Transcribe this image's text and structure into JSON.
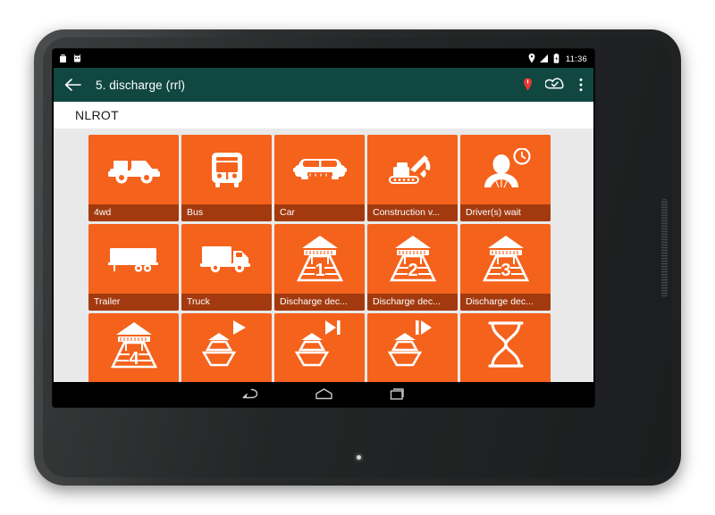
{
  "device": {
    "type": "android-tablet"
  },
  "statusbar": {
    "left_icons": [
      "shopping-bag-icon",
      "robot-icon"
    ],
    "right_icons": [
      "location-icon",
      "signal-icon",
      "battery-icon"
    ],
    "time": "11:36"
  },
  "appbar": {
    "back_label": "back-arrow",
    "title": "5. discharge (rrl)",
    "actions": [
      {
        "name": "location-pin-icon",
        "color": "#e53935"
      },
      {
        "name": "cloud-check-icon",
        "color": "#ffffff"
      },
      {
        "name": "overflow-menu-icon",
        "color": "#ffffff"
      }
    ]
  },
  "subheader": {
    "title": "NLROT"
  },
  "colors": {
    "tile": "#f4621c",
    "tile_label_band": "#a33a0f",
    "appbar": "#114741",
    "background": "#e9e9e9",
    "accent_red": "#e53935"
  },
  "grid": {
    "columns": 5,
    "tiles": [
      {
        "label": "4wd",
        "icon": "suv-icon"
      },
      {
        "label": "Bus",
        "icon": "bus-icon"
      },
      {
        "label": "Car",
        "icon": "car-icon"
      },
      {
        "label": "Construction v...",
        "icon": "excavator-icon"
      },
      {
        "label": "Driver(s) wait",
        "icon": "driver-waiting-clock-icon"
      },
      {
        "label": "Trailer",
        "icon": "trailer-icon"
      },
      {
        "label": "Truck",
        "icon": "truck-icon"
      },
      {
        "label": "Discharge dec...",
        "icon": "discharge-deck-1-icon"
      },
      {
        "label": "Discharge dec...",
        "icon": "discharge-deck-2-icon"
      },
      {
        "label": "Discharge dec...",
        "icon": "discharge-deck-3-icon"
      },
      {
        "label": "",
        "icon": "discharge-deck-4-icon"
      },
      {
        "label": "",
        "icon": "ship-play-icon"
      },
      {
        "label": "",
        "icon": "ship-skip-end-icon"
      },
      {
        "label": "",
        "icon": "ship-play-start-icon"
      },
      {
        "label": "",
        "icon": "hourglass-icon"
      }
    ]
  },
  "navbar": {
    "buttons": [
      {
        "name": "nav-back-button"
      },
      {
        "name": "nav-home-button"
      },
      {
        "name": "nav-recents-button"
      }
    ]
  }
}
